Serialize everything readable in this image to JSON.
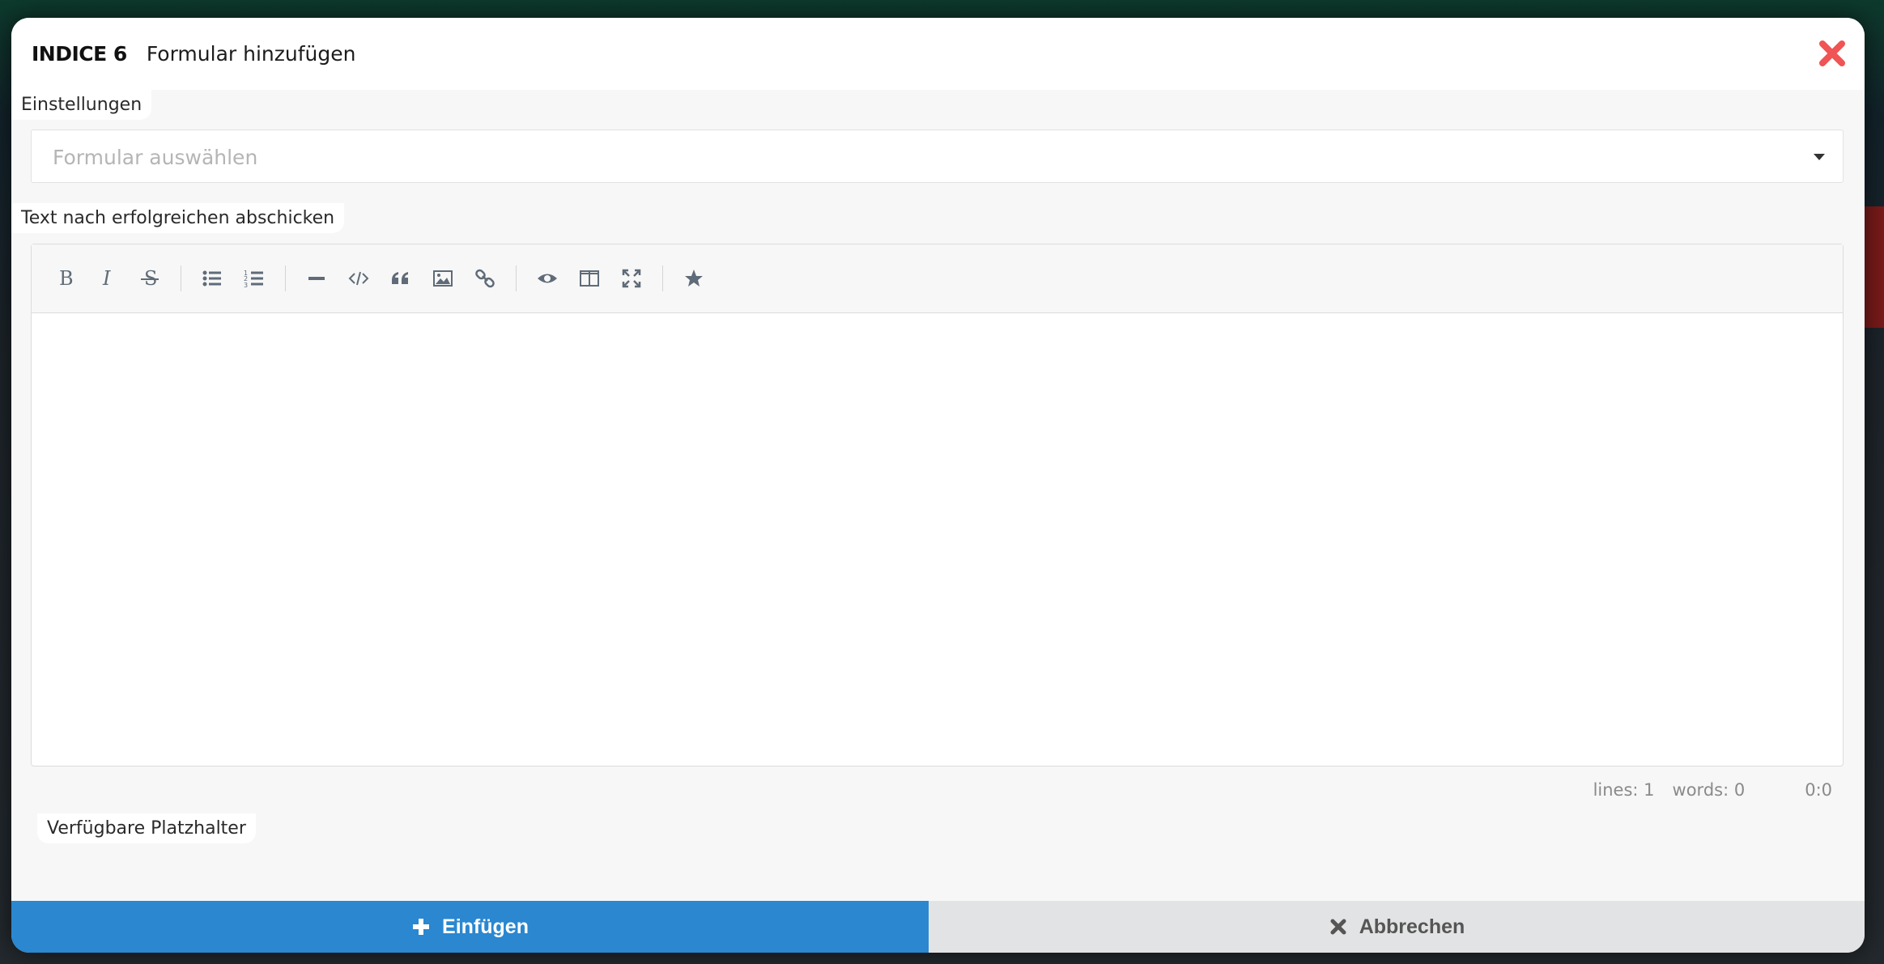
{
  "modal": {
    "indice": "INDICE 6",
    "title": "Formular hinzufügen"
  },
  "settings": {
    "label": "Einstellungen",
    "form_select_placeholder": "Formular auswählen"
  },
  "success_text": {
    "label": "Text nach erfolgreichen abschicken"
  },
  "editor": {
    "toolbar_icons": [
      "bold-icon",
      "italic-icon",
      "strikethrough-icon",
      "unordered-list-icon",
      "ordered-list-icon",
      "horizontal-rule-icon",
      "code-icon",
      "quote-icon",
      "image-icon",
      "link-icon",
      "preview-icon",
      "side-by-side-icon",
      "fullscreen-icon",
      "star-icon"
    ],
    "status": {
      "lines": "lines: 1",
      "words": "words: 0",
      "cursor": "0:0"
    }
  },
  "placeholders": {
    "label": "Verfügbare Platzhalter"
  },
  "footer": {
    "insert_label": "Einfügen",
    "cancel_label": "Abbrechen"
  },
  "colors": {
    "primary": "#2a87d0",
    "close": "#f05454",
    "cancel_bg": "#e2e3e4"
  }
}
